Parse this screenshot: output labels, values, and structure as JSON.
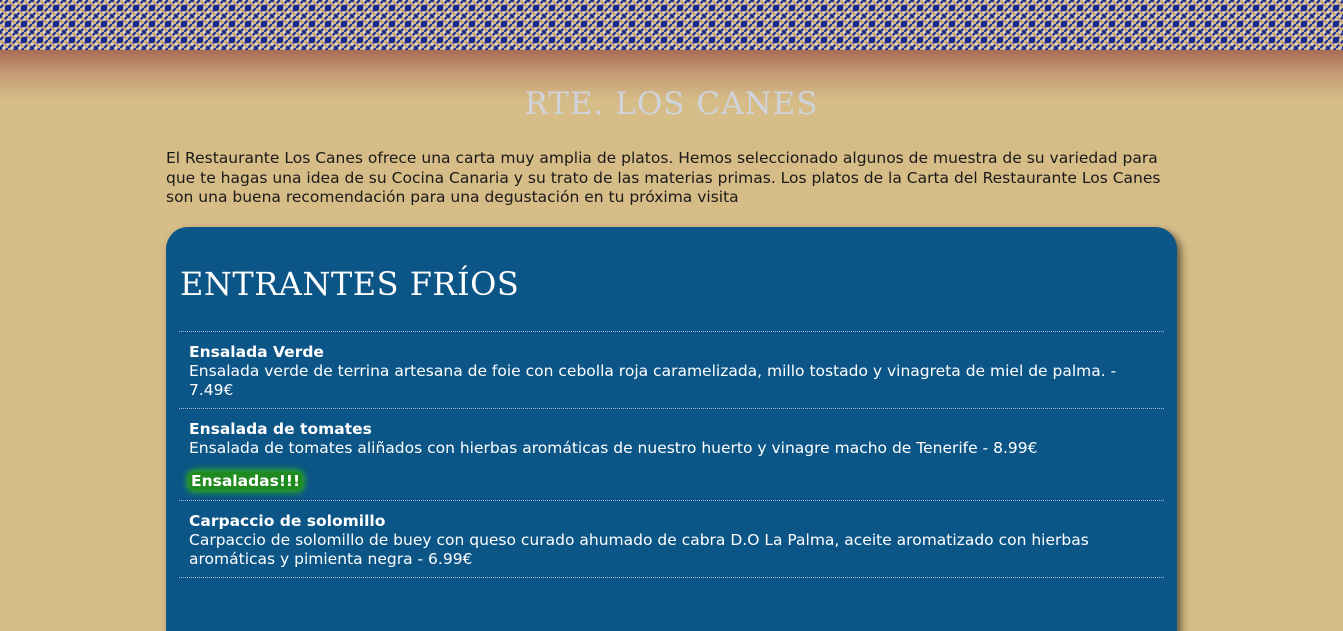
{
  "site": {
    "title": "RTE. LOS CANES",
    "intro": "El Restaurante Los Canes ofrece una carta muy amplia de platos. Hemos seleccionado algunos de muestra de su variedad para que te hagas una idea de su Cocina Canaria y su trato de las materias primas. Los platos de la Carta del Restaurante Los Canes son una buena recomendación para una degustación en tu próxima visita"
  },
  "menu": {
    "section_title": "ENTRANTES FRÍOS",
    "dishes": [
      {
        "name": "Ensalada Verde",
        "description": "Ensalada verde de terrina artesana de foie con cebolla roja caramelizada, millo tostado y vinagreta de miel de palma. - 7.49€"
      },
      {
        "name": "Ensalada de tomates",
        "description": "Ensalada de tomates aliñados con hierbas aromáticas de nuestro huerto y vinagre macho de Tenerife - 8.99€",
        "tag": "Ensaladas!!!"
      },
      {
        "name": "Carpaccio de solomillo",
        "description": "Carpaccio de solomillo de buey con queso curado ahumado de cabra D.O La Palma, aceite aromatizado con hierbas aromáticas y pimienta negra - 6.99€"
      }
    ]
  },
  "colors": {
    "page_background": "#d6bc86",
    "panel_background": "#0b5587",
    "title_color": "#cfd3dc",
    "tag_background": "#1f8a1f"
  }
}
